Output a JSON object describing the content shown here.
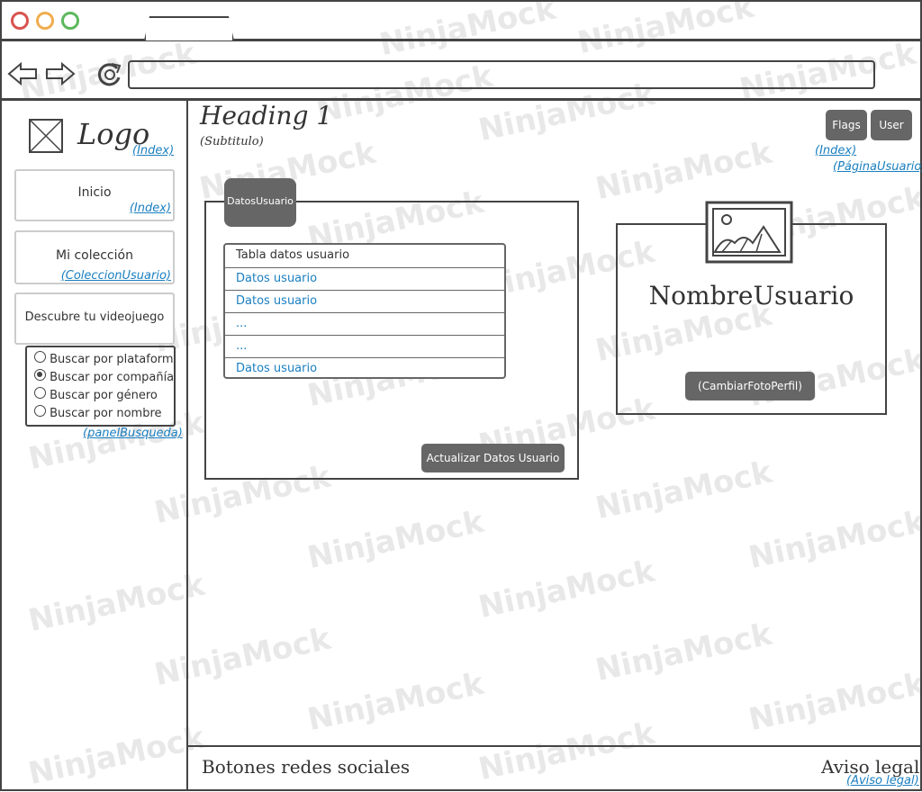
{
  "browser": {
    "window_controls": {
      "close_color": "#d9534f",
      "minimize_color": "#f0ad4e",
      "maximize_color": "#5cb85c"
    },
    "address_value": ""
  },
  "sidebar": {
    "logo_text": "Logo",
    "logo_link": "(Index)",
    "items": [
      {
        "label": "Inicio",
        "link": "(Index)"
      },
      {
        "label": "Mi colección",
        "link": "(ColeccionUsuario)"
      },
      {
        "label": "Descubre tu videojuego",
        "link": ""
      }
    ],
    "search_options": [
      {
        "label": "Buscar por plataforma",
        "selected": false
      },
      {
        "label": "Buscar por compañía",
        "selected": true
      },
      {
        "label": "Buscar por género",
        "selected": false
      },
      {
        "label": "Buscar por nombre",
        "selected": false
      }
    ],
    "search_panel_link": "(panelBusqueda)"
  },
  "header": {
    "heading": "Heading 1",
    "subtitle": "(Subtitulo)",
    "flags_button": "Flags",
    "user_button": "User",
    "flags_link": "(Index)",
    "user_link": "(PáginaUsuario)"
  },
  "datos_panel": {
    "tab_label": "DatosUsuario",
    "table_header": "Tabla datos usuario",
    "rows": [
      "Datos usuario",
      "Datos usuario",
      "...",
      "...",
      "Datos usuario"
    ],
    "update_button": "Actualizar Datos Usuario"
  },
  "profile_panel": {
    "username": "NombreUsuario",
    "change_photo_button": "(CambiarFotoPerfil)"
  },
  "footer": {
    "social_label": "Botones redes sociales",
    "legal_label": "Aviso legal",
    "legal_link": "(Aviso legal)"
  },
  "watermark_text": "NinjaMock"
}
